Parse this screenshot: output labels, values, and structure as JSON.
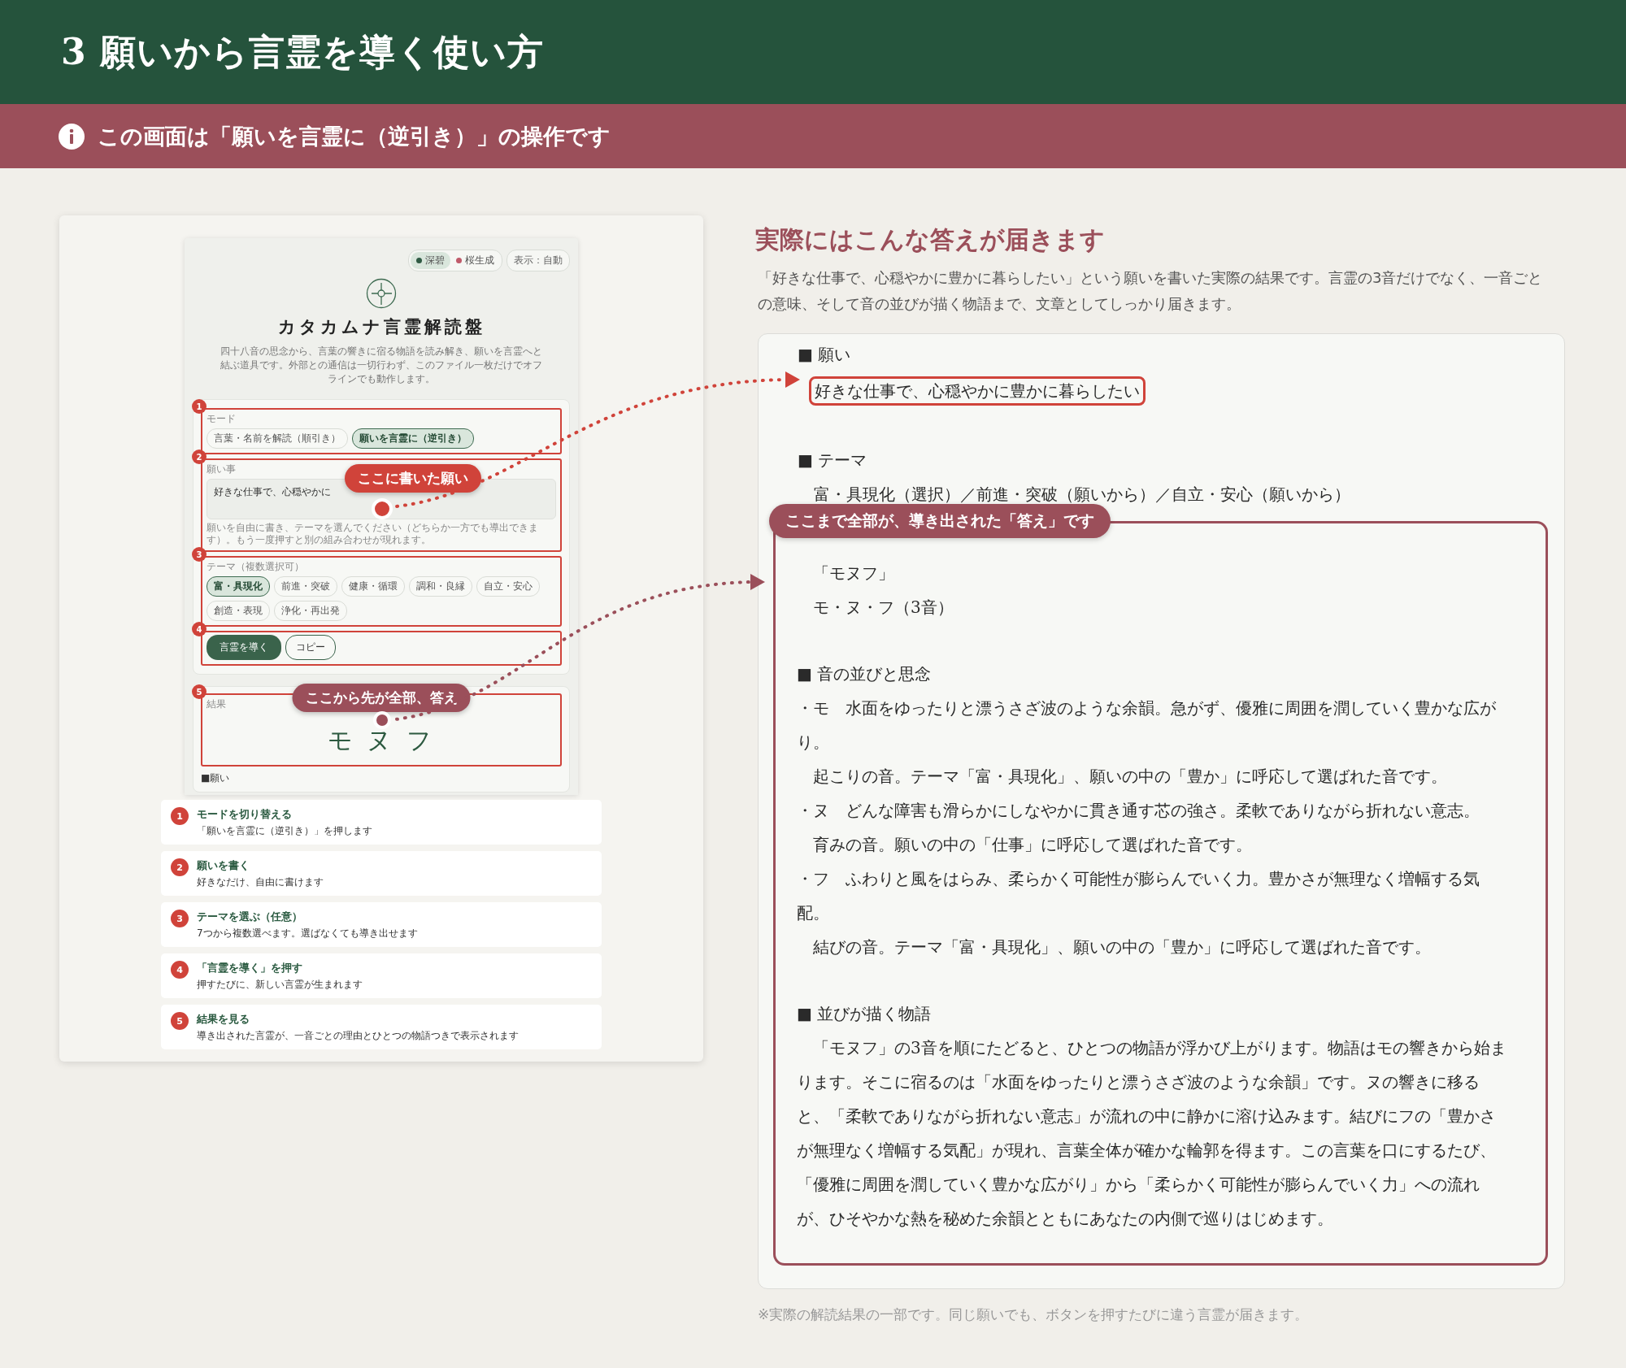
{
  "header": {
    "title": "3 願いから言霊を導く使い方"
  },
  "notice": {
    "text": "この画面は「願いを言霊に（逆引き）」の操作です"
  },
  "app_preview": {
    "palette": [
      {
        "label": "深碧",
        "color": "#2f5a43",
        "selected": true
      },
      {
        "label": "桜生成",
        "color": "#c05a6a",
        "selected": false
      }
    ],
    "display_button": "表示：自動",
    "title": "カタカムナ言霊解読盤",
    "description": "四十八音の思念から、言葉の響きに宿る物語を読み解き、願いを言霊へと結ぶ道具です。外部との通信は一切行わず、このファイル一枚だけでオフラインでも動作します。",
    "mode": {
      "marker": "1",
      "label": "モード",
      "options": [
        {
          "label": "言葉・名前を解読（順引き）",
          "selected": false
        },
        {
          "label": "願いを言霊に（逆引き）",
          "selected": true
        }
      ]
    },
    "wish": {
      "marker": "2",
      "label": "願い事",
      "value": "好きな仕事で、心穏やかに",
      "hint": "願いを自由に書き、テーマを選んでください（どちらか一方でも導出できます）。もう一度押すと別の組み合わせが現れます。"
    },
    "themes": {
      "marker": "3",
      "label": "テーマ（複数選択可）",
      "options": [
        {
          "label": "富・具現化",
          "selected": true
        },
        {
          "label": "前進・突破",
          "selected": false
        },
        {
          "label": "健康・循環",
          "selected": false
        },
        {
          "label": "調和・良縁",
          "selected": false
        },
        {
          "label": "自立・安心",
          "selected": false
        },
        {
          "label": "創造・表現",
          "selected": false
        },
        {
          "label": "浄化・再出発",
          "selected": false
        }
      ]
    },
    "actions": {
      "marker": "4",
      "derive_button": "言霊を導く",
      "copy_button": "コピー"
    },
    "result": {
      "marker": "5",
      "label": "結果",
      "word": "モ ヌ フ",
      "section": "■願い"
    }
  },
  "callouts": [
    {
      "text": "ここに書いた願い",
      "color": "#d0433a"
    },
    {
      "text": "ここから先が全部、答え",
      "color": "#9b4f5a"
    }
  ],
  "steps": [
    {
      "number": "1",
      "title": "モードを切り替える",
      "detail": "「願いを言霊に（逆引き）」を押します"
    },
    {
      "number": "2",
      "title": "願いを書く",
      "detail": "好きなだけ、自由に書けます"
    },
    {
      "number": "3",
      "title": "テーマを選ぶ（任意）",
      "detail": "7つから複数選べます。選ばなくても導き出せます"
    },
    {
      "number": "4",
      "title": "「言霊を導く」を押す",
      "detail": "押すたびに、新しい言霊が生まれます"
    },
    {
      "number": "5",
      "title": "結果を見る",
      "detail": "導き出された言霊が、一音ごとの理由とひとつの物語つきで表示されます"
    }
  ],
  "answer": {
    "heading": "実際にはこんな答えが届きます",
    "intro": "「好きな仕事で、心穏やかに豊かに暮らしたい」という願いを書いた実際の結果です。言霊の3音だけでなく、一音ごとの意味、そして音の並びが描く物語まで、文章としてしっかり届きます。",
    "wish_heading": "■ 願い",
    "wish": "好きな仕事で、心穏やかに豊かに暮らしたい",
    "theme_heading": "■ テーマ",
    "theme": "富・具現化（選択）／前進・突破（願いから）／自立・安心（願いから）",
    "frame_label": "ここまで全部が、導き出された「答え」です",
    "word_lines": [
      "「モヌフ」",
      "モ・ヌ・フ（3音）"
    ],
    "order_heading": "■ 音の並びと思念",
    "sounds": [
      {
        "text": "・モ　水面をゆったりと漂うさざ波のような余韻。急がず、優雅に周囲を潤していく豊かな広がり。",
        "note": "起こりの音。テーマ「富・具現化」、願いの中の「豊か」に呼応して選ばれた音です。"
      },
      {
        "text": "・ヌ　どんな障害も滑らかにしなやかに貫き通す芯の強さ。柔軟でありながら折れない意志。",
        "note": "育みの音。願いの中の「仕事」に呼応して選ばれた音です。"
      },
      {
        "text": "・フ　ふわりと風をはらみ、柔らかく可能性が膨らんでいく力。豊かさが無理なく増幅する気配。",
        "note": "結びの音。テーマ「富・具現化」、願いの中の「豊か」に呼応して選ばれた音です。"
      }
    ],
    "story_heading": "■ 並びが描く物語",
    "story": "「モヌフ」の3音を順にたどると、ひとつの物語が浮かび上がります。物語はモの響きから始まります。そこに宿るのは「水面をゆったりと漂うさざ波のような余韻」です。ヌの響きに移ると、「柔軟でありながら折れない意志」が流れの中に静かに溶け込みます。結びにフの「豊かさが無理なく増幅する気配」が現れ、言葉全体が確かな輪郭を得ます。この言葉を口にするたび、「優雅に周囲を潤していく豊かな広がり」から「柔らかく可能性が膨らんでいく力」への流れが、ひそやかな熱を秘めた余韻とともにあなたの内側で巡りはじめます。",
    "footnote": "※実際の解読結果の一部です。同じ願いでも、ボタンを押すたびに違う言霊が届きます。"
  }
}
